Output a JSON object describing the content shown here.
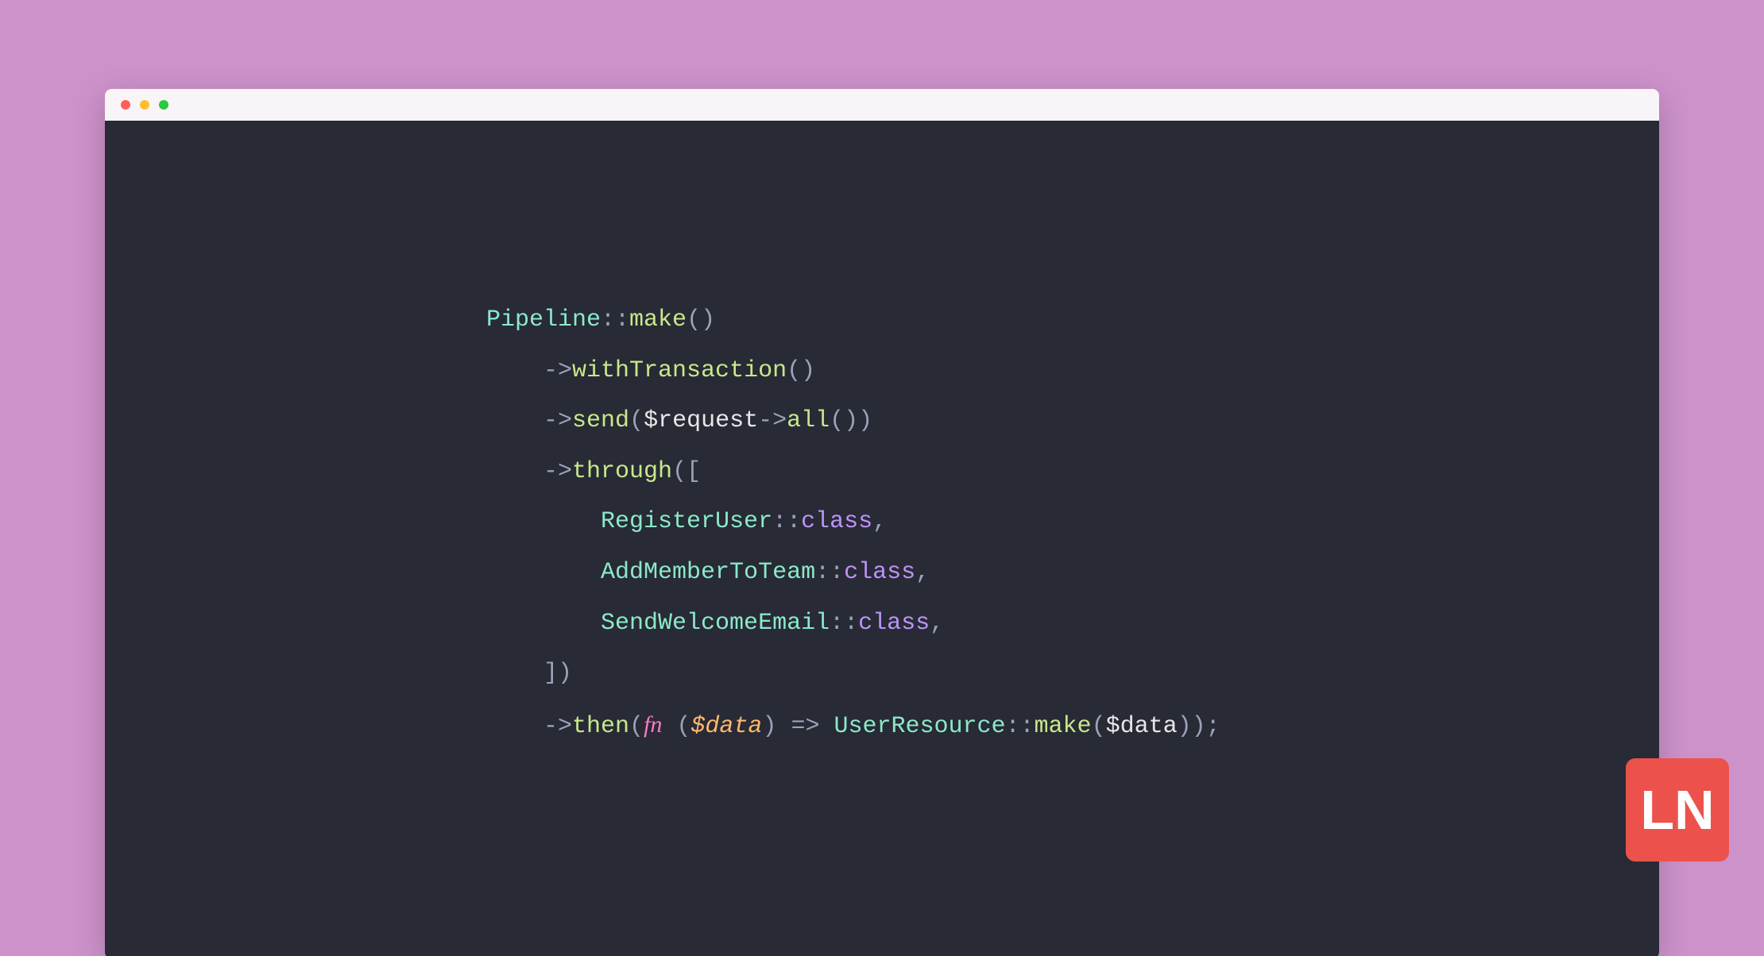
{
  "code": {
    "tokens": [
      [
        {
          "t": "Pipeline",
          "c": "c-class"
        },
        {
          "t": "::",
          "c": "c-punct"
        },
        {
          "t": "make",
          "c": "c-method"
        },
        {
          "t": "()",
          "c": "c-punct"
        }
      ],
      [
        {
          "t": "    ",
          "c": ""
        },
        {
          "t": "->",
          "c": "c-punct"
        },
        {
          "t": "withTransaction",
          "c": "c-method"
        },
        {
          "t": "()",
          "c": "c-punct"
        }
      ],
      [
        {
          "t": "    ",
          "c": ""
        },
        {
          "t": "->",
          "c": "c-punct"
        },
        {
          "t": "send",
          "c": "c-method"
        },
        {
          "t": "(",
          "c": "c-punct"
        },
        {
          "t": "$request",
          "c": "c-var"
        },
        {
          "t": "->",
          "c": "c-punct"
        },
        {
          "t": "all",
          "c": "c-method"
        },
        {
          "t": "())",
          "c": "c-punct"
        }
      ],
      [
        {
          "t": "    ",
          "c": ""
        },
        {
          "t": "->",
          "c": "c-punct"
        },
        {
          "t": "through",
          "c": "c-method"
        },
        {
          "t": "([",
          "c": "c-punct"
        }
      ],
      [
        {
          "t": "        ",
          "c": ""
        },
        {
          "t": "RegisterUser",
          "c": "c-class"
        },
        {
          "t": "::",
          "c": "c-punct"
        },
        {
          "t": "class",
          "c": "c-const"
        },
        {
          "t": ",",
          "c": "c-punct"
        }
      ],
      [
        {
          "t": "        ",
          "c": ""
        },
        {
          "t": "AddMemberToTeam",
          "c": "c-class"
        },
        {
          "t": "::",
          "c": "c-punct"
        },
        {
          "t": "class",
          "c": "c-const"
        },
        {
          "t": ",",
          "c": "c-punct"
        }
      ],
      [
        {
          "t": "        ",
          "c": ""
        },
        {
          "t": "SendWelcomeEmail",
          "c": "c-class"
        },
        {
          "t": "::",
          "c": "c-punct"
        },
        {
          "t": "class",
          "c": "c-const"
        },
        {
          "t": ",",
          "c": "c-punct"
        }
      ],
      [
        {
          "t": "    ",
          "c": ""
        },
        {
          "t": "])",
          "c": "c-punct"
        }
      ],
      [
        {
          "t": "    ",
          "c": ""
        },
        {
          "t": "->",
          "c": "c-punct"
        },
        {
          "t": "then",
          "c": "c-method"
        },
        {
          "t": "(",
          "c": "c-punct"
        },
        {
          "t": "fn",
          "c": "c-kw-fn"
        },
        {
          "t": " (",
          "c": "c-punct"
        },
        {
          "t": "$data",
          "c": "c-param"
        },
        {
          "t": ") ",
          "c": "c-punct"
        },
        {
          "t": "=>",
          "c": "c-punct"
        },
        {
          "t": " ",
          "c": ""
        },
        {
          "t": "UserResource",
          "c": "c-class"
        },
        {
          "t": "::",
          "c": "c-punct"
        },
        {
          "t": "make",
          "c": "c-method"
        },
        {
          "t": "(",
          "c": "c-punct"
        },
        {
          "t": "$data",
          "c": "c-var"
        },
        {
          "t": "));",
          "c": "c-punct"
        }
      ]
    ]
  },
  "logo": {
    "text": "LN"
  },
  "colors": {
    "background": "#cd92ca",
    "editor_bg": "#282a36",
    "titlebar_bg": "#f9f4f8",
    "logo_bg": "#ec524b",
    "syntax": {
      "class": "#8be9c9",
      "punct": "#9aa3b8",
      "method": "#c8e88a",
      "var": "#e8e8e8",
      "param": "#ffb86c",
      "const": "#bd93f9",
      "kw": "#ff79c6"
    }
  }
}
